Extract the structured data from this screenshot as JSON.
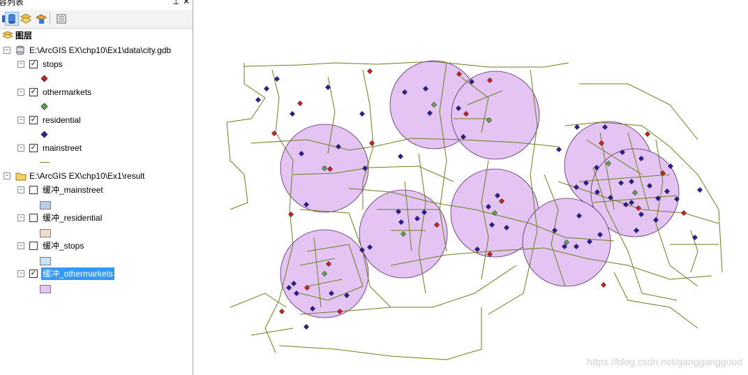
{
  "toc": {
    "title": "容列表",
    "toolbar": [
      {
        "name": "list-by-drawing-order-icon"
      },
      {
        "name": "list-by-source-icon"
      },
      {
        "name": "list-by-visibility-icon"
      },
      {
        "name": "list-by-selection-icon"
      },
      {
        "name": "options-icon"
      }
    ],
    "root": "图层",
    "groups": [
      {
        "path": "E:\\ArcGIS EX\\chp10\\Ex1\\data\\city.gdb",
        "icon": "geodatabase-icon",
        "layers": [
          {
            "name": "stops",
            "checked": true,
            "legend": "point",
            "color": "#e21b1b"
          },
          {
            "name": "othermarkets",
            "checked": true,
            "legend": "point",
            "color": "#5fae4a"
          },
          {
            "name": "residential",
            "checked": true,
            "legend": "point",
            "color": "#2d1aa8"
          },
          {
            "name": "mainstreet",
            "checked": true,
            "legend": "line",
            "color": "#6b7d1c"
          }
        ]
      },
      {
        "path": "E:\\ArcGIS EX\\chp10\\Ex1\\result",
        "icon": "folder-icon",
        "layers": [
          {
            "name": "缓冲_mainstreet",
            "checked": false,
            "legend": "fill",
            "color": "#bccde8"
          },
          {
            "name": "缓冲_residential",
            "checked": false,
            "legend": "fill",
            "color": "#f2dcc8"
          },
          {
            "name": "缓冲_stops",
            "checked": false,
            "legend": "fill",
            "color": "#c9e1f2"
          },
          {
            "name": "缓冲_othermarkets",
            "checked": true,
            "legend": "fill",
            "color": "#e4c4f2",
            "selected": true
          }
        ]
      }
    ]
  },
  "map": {
    "buffer_fill": "#e4c4f2",
    "street_color": "#6b7d1c",
    "watermark": "https://blog.csdn.net/gangganggood"
  }
}
